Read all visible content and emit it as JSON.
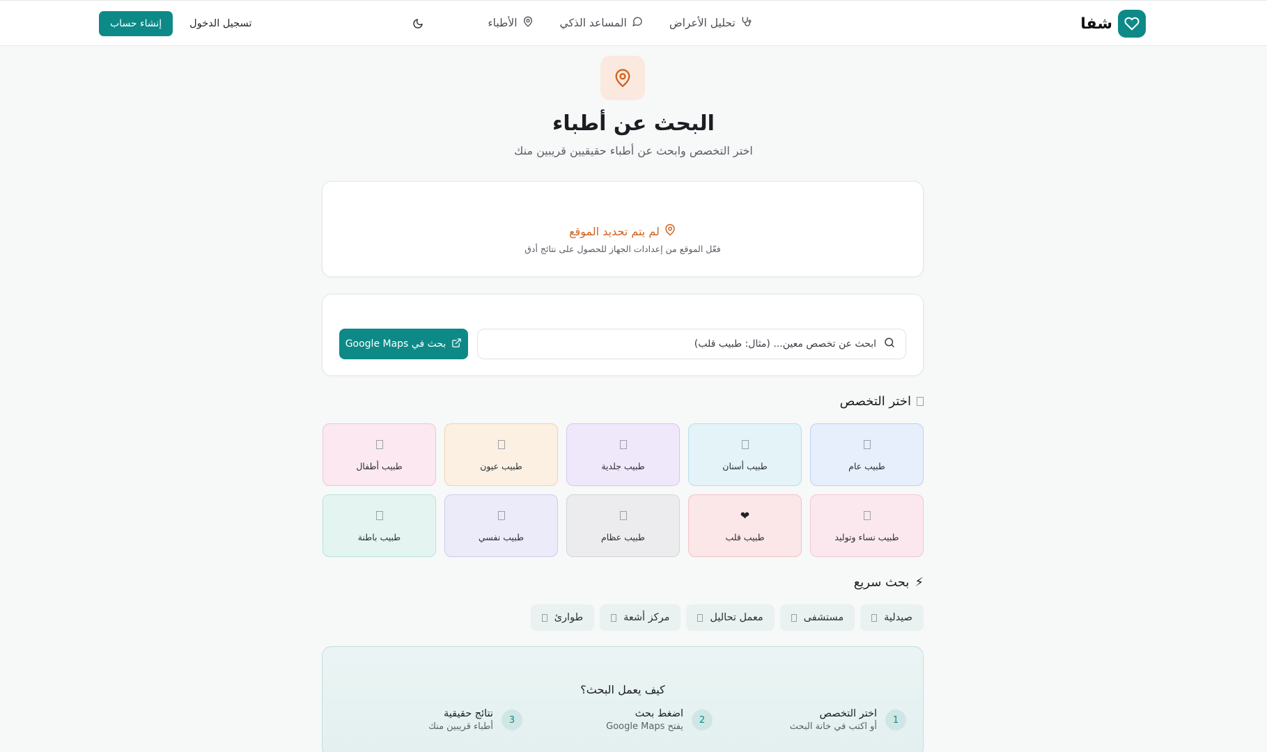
{
  "header": {
    "brand_name": "شفا",
    "nav": [
      {
        "label": "تحليل الأعراض",
        "icon": "stethoscope-icon"
      },
      {
        "label": "المساعد الذكي",
        "icon": "chat-bubble-icon"
      },
      {
        "label": "الأطباء",
        "icon": "map-pin-icon"
      }
    ],
    "login_label": "تسجيل الدخول",
    "signup_label": "إنشاء حساب",
    "theme_icon": "moon-icon"
  },
  "hero": {
    "icon": "map-pin-icon",
    "title": "البحث عن أطباء",
    "subtitle": "اختر التخصص وابحث عن أطباء حقيقيين قريبين منك"
  },
  "location": {
    "title": "لم يتم تحديد الموقع",
    "hint": "فعّل الموقع من إعدادات الجهاز للحصول على نتائج أدق"
  },
  "search": {
    "placeholder": "ابحث عن تخصص معين... (مثال: طبيب قلب)",
    "maps_button": "بحث في Google Maps"
  },
  "specialties": {
    "heading": "اختر التخصص",
    "items": [
      {
        "label": "طبيب عام",
        "glyph": "",
        "bg": "#e6effb",
        "border": "#bcd3ef"
      },
      {
        "label": "طبيب أسنان",
        "glyph": "",
        "bg": "#e3f3f7",
        "border": "#b5dfe9"
      },
      {
        "label": "طبيب جلدية",
        "glyph": "",
        "bg": "#efe8fb",
        "border": "#d6c6f1"
      },
      {
        "label": "طبيب عيون",
        "glyph": "",
        "bg": "#fbf0e2",
        "border": "#f1d4a9"
      },
      {
        "label": "طبيب أطفال",
        "glyph": "",
        "bg": "#fbe8f1",
        "border": "#f0c4da"
      },
      {
        "label": "طبيب نساء وتوليد",
        "glyph": "",
        "bg": "#fbe8ee",
        "border": "#f1c5d2"
      },
      {
        "label": "طبيب قلب",
        "glyph": "❤",
        "bg": "#fbe6e8",
        "border": "#f1c3c8"
      },
      {
        "label": "طبيب عظام",
        "glyph": "",
        "bg": "#ececee",
        "border": "#d3d5d9"
      },
      {
        "label": "طبيب نفسي",
        "glyph": "",
        "bg": "#ecebfa",
        "border": "#cfcbf0"
      },
      {
        "label": "طبيب باطنة",
        "glyph": "",
        "bg": "#e4f5f1",
        "border": "#b7e3d8"
      }
    ]
  },
  "quick_search": {
    "heading": "بحث سريع",
    "heading_icon": "⚡",
    "chips": [
      "صيدلية",
      "مستشفى",
      "معمل تحاليل",
      "مركز أشعة",
      "طوارئ"
    ]
  },
  "how_it_works": {
    "title": "كيف يعمل البحث؟",
    "steps": [
      {
        "num": "1",
        "title": "اختر التخصص",
        "desc": "أو اكتب في خانة البحث"
      },
      {
        "num": "2",
        "title": "اضغط بحث",
        "desc": "يفتح Google Maps"
      },
      {
        "num": "3",
        "title": "نتائج حقيقية",
        "desc": "أطباء قريبين منك"
      }
    ]
  }
}
